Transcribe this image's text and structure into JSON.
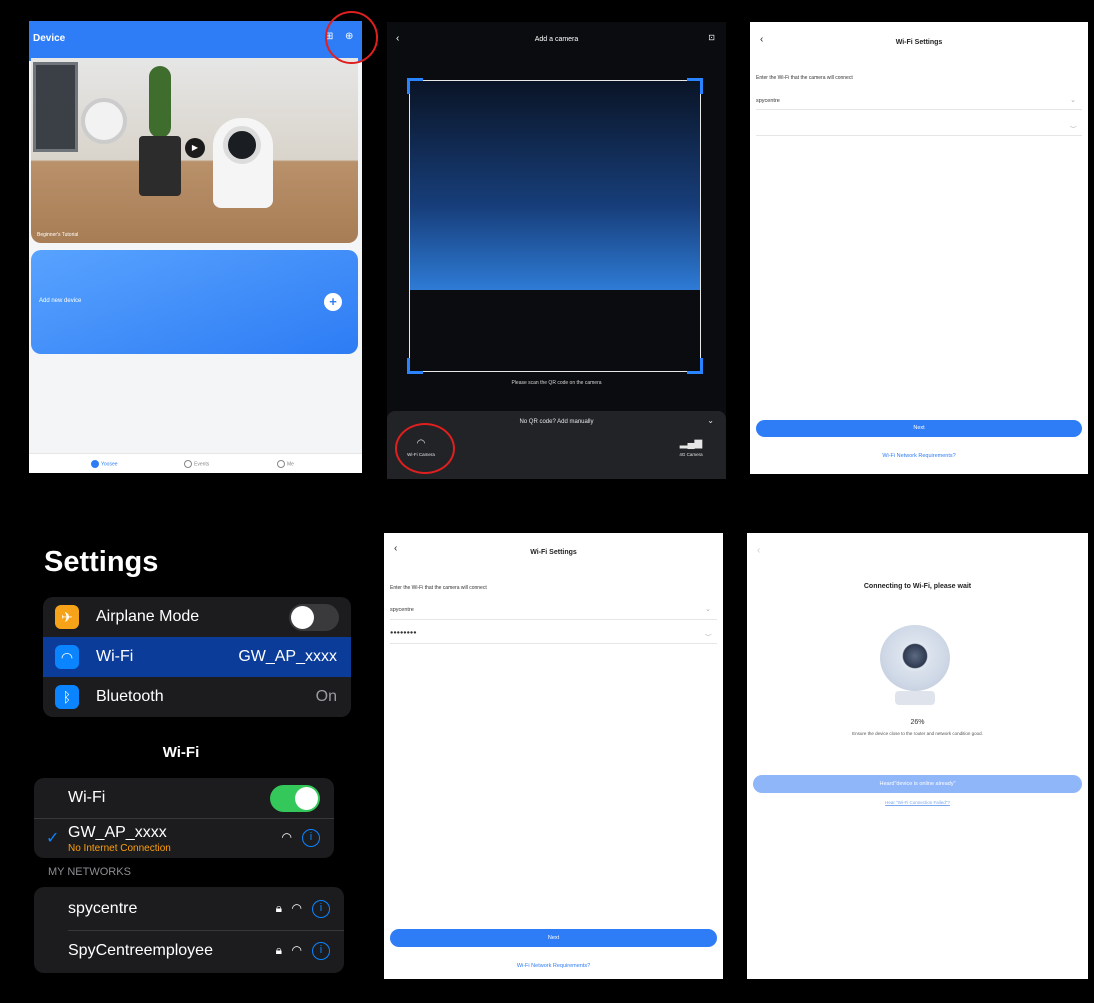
{
  "panel_device": {
    "title": "Device",
    "hero_label": "Beginner's Tutorial",
    "add_device_label": "Add new device",
    "tabs": [
      {
        "label": "Yoosee",
        "active": true
      },
      {
        "label": "Events",
        "active": false
      },
      {
        "label": "Me",
        "active": false
      }
    ],
    "accent_color": "#2f7df6"
  },
  "panel_add_camera": {
    "title": "Add a camera",
    "scan_hint": "Please scan the QR code on the camera",
    "drawer_title": "No QR code? Add manually",
    "options": [
      {
        "label": "Wi-Fi Camera",
        "icon": "wifi-icon"
      },
      {
        "label": "4G Camera",
        "icon": "cellular-signal-icon"
      }
    ]
  },
  "panel_wifi_settings_empty": {
    "title": "Wi-Fi Settings",
    "prompt": "Enter the Wi-Fi that the camera will connect",
    "ssid_value": "spycentre",
    "password_value": "",
    "next_label": "Next",
    "requirements_link": "Wi-Fi Network Requirements?"
  },
  "panel_ios_settings": {
    "title": "Settings",
    "rows": [
      {
        "label": "Airplane Mode",
        "value": "",
        "icon": "airplane-icon",
        "toggle": false
      },
      {
        "label": "Wi-Fi",
        "value": "GW_AP_xxxx",
        "icon": "wifi-icon",
        "selected": true
      },
      {
        "label": "Bluetooth",
        "value": "On",
        "icon": "bluetooth-icon"
      }
    ],
    "wifi_section_title": "Wi-Fi",
    "wifi_toggle_label": "Wi-Fi",
    "wifi_toggle_on": true,
    "connected_network": "GW_AP_xxxx",
    "connected_status": "No Internet Connection",
    "my_networks_caption": "MY NETWORKS",
    "networks": [
      {
        "name": "spycentre"
      },
      {
        "name": "SpyCentreemployee"
      }
    ],
    "green": "#34c759",
    "blue": "#0a84ff",
    "status_orange": "#ff9f0a"
  },
  "panel_wifi_settings_filled": {
    "title": "Wi-Fi Settings",
    "prompt": "Enter the Wi-Fi that the camera will connect",
    "ssid_value": "spycentre",
    "password_value": "●●●●●●●●",
    "next_label": "Next",
    "requirements_link": "Wi-Fi Network Requirements?"
  },
  "panel_connecting": {
    "title": "Connecting to Wi-Fi, please wait",
    "progress": "26%",
    "note": "Ensure the device close to the router and network condition good.",
    "primary_button": "Heard\"device is online already\"",
    "secondary_link": "Hear \"Wi-Fi Connection Failed\"?"
  }
}
